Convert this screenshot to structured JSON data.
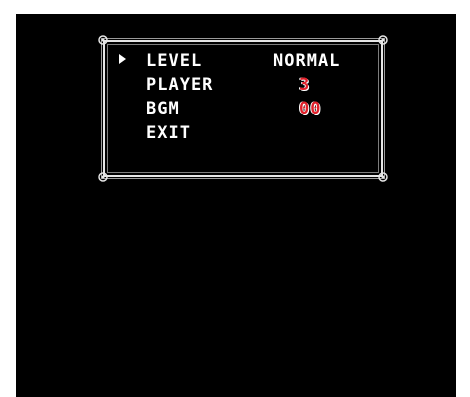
{
  "options_menu": {
    "items": [
      {
        "label": "LEVEL",
        "value": "NORMAL"
      },
      {
        "label": "PLAYER",
        "value": "3"
      },
      {
        "label": "BGM",
        "value": "00"
      },
      {
        "label": "EXIT"
      }
    ],
    "selected_index": 0,
    "cursor_icon": "right-triangle-cursor"
  },
  "colors": {
    "background": "#000000",
    "text": "#ffffff",
    "value_highlight": "#e0202a",
    "border": "#e6e6e6"
  }
}
